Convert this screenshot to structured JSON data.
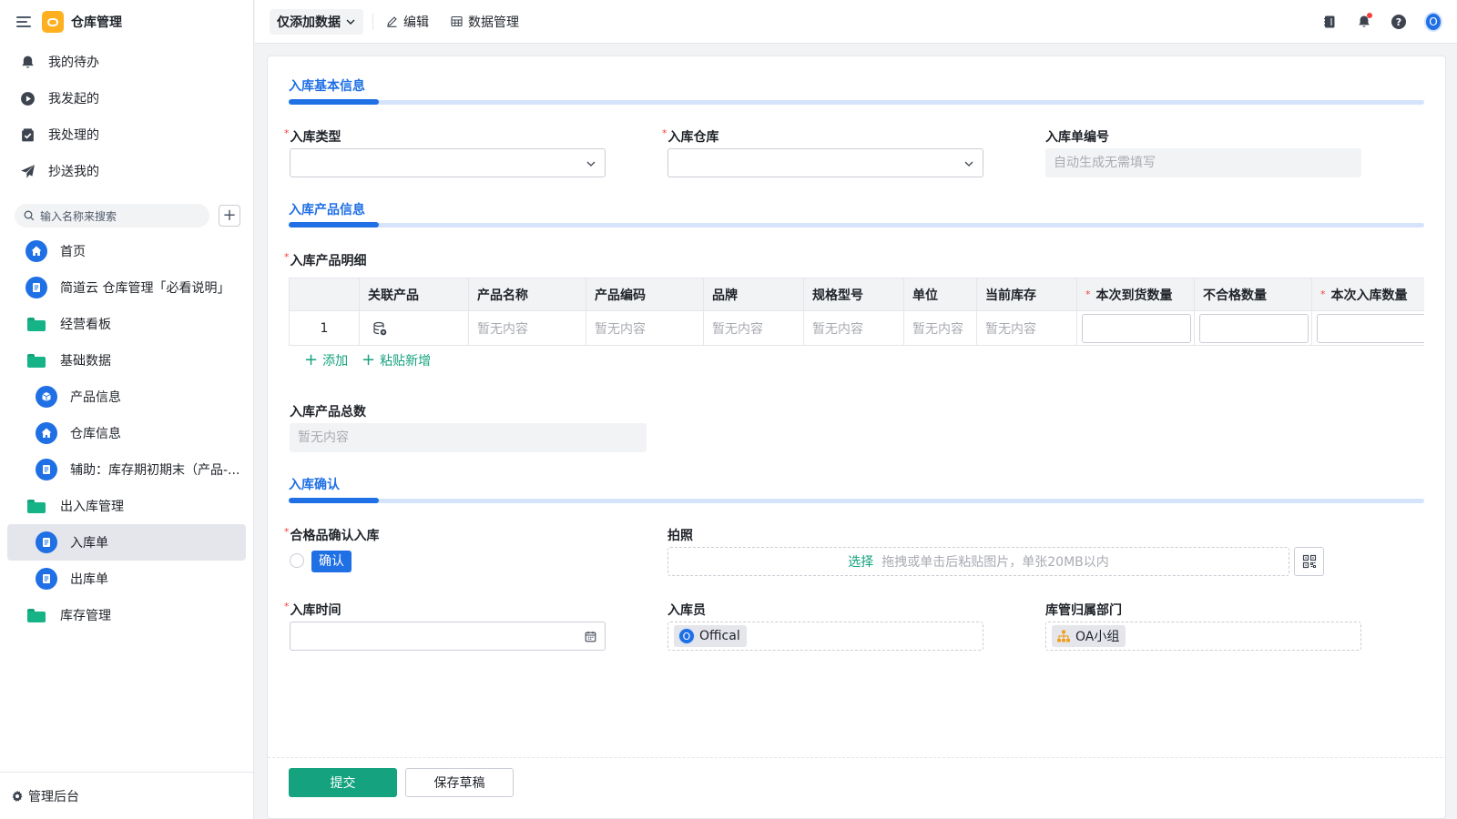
{
  "app": {
    "title": "仓库管理"
  },
  "todos": [
    {
      "icon": "bell-icon",
      "label": "我的待办"
    },
    {
      "icon": "play-circle-icon",
      "label": "我发起的"
    },
    {
      "icon": "check-box-icon",
      "label": "我处理的"
    },
    {
      "icon": "send-icon",
      "label": "抄送我的"
    }
  ],
  "search": {
    "placeholder": "输入名称来搜索"
  },
  "nav": [
    {
      "label": "首页",
      "icon": "home-icon"
    },
    {
      "label": "简道云 仓库管理「必看说明」",
      "icon": "document-icon"
    },
    {
      "label": "经营看板",
      "icon": "folder-icon"
    },
    {
      "label": "基础数据",
      "icon": "folder-open-icon"
    },
    {
      "label": "产品信息",
      "icon": "box-icon"
    },
    {
      "label": "仓库信息",
      "icon": "home-icon"
    },
    {
      "label": "辅助：库存期初期末（产品-...",
      "icon": "document-icon"
    },
    {
      "label": "出入库管理",
      "icon": "folder-open-icon"
    },
    {
      "label": "入库单",
      "icon": "document-icon"
    },
    {
      "label": "出库单",
      "icon": "document-icon"
    },
    {
      "label": "库存管理",
      "icon": "folder-icon"
    }
  ],
  "admin": {
    "label": "管理后台"
  },
  "toolbar": {
    "view": "仅添加数据",
    "edit": "编辑",
    "data_manage": "数据管理",
    "avatar": "O"
  },
  "sections": {
    "basic": "入库基本信息",
    "product": "入库产品信息",
    "confirm": "入库确认"
  },
  "fields": {
    "type": {
      "label": "入库类型",
      "required": "*"
    },
    "warehouse": {
      "label": "入库仓库",
      "required": "*"
    },
    "number": {
      "label": "入库单编号",
      "placeholder": "自动生成无需填写"
    },
    "detail": {
      "label": "入库产品明细",
      "required": "*"
    },
    "total": {
      "label": "入库产品总数",
      "placeholder": "暂无内容"
    },
    "qualified": {
      "label": "合格品确认入库",
      "required": "*",
      "option": "确认"
    },
    "photo": {
      "label": "拍照",
      "pick": "选择",
      "hint": "拖拽或单击后粘贴图片，单张20MB以内"
    },
    "time": {
      "label": "入库时间",
      "required": "*"
    },
    "operator": {
      "label": "入库员",
      "value": "Offical",
      "avatar": "O"
    },
    "department": {
      "label": "库管归属部门",
      "value": "OA小组"
    }
  },
  "table": {
    "columns": [
      "",
      "关联产品",
      "产品名称",
      "产品编码",
      "品牌",
      "规格型号",
      "单位",
      "当前库存",
      "本次到货数量",
      "不合格数量",
      "本次入库数量"
    ],
    "required_mark": "*",
    "row": {
      "index": "1",
      "empty": "暂无内容"
    }
  },
  "actions": {
    "add": "添加",
    "paste_add": "粘贴新增",
    "submit": "提交",
    "draft": "保存草稿"
  }
}
